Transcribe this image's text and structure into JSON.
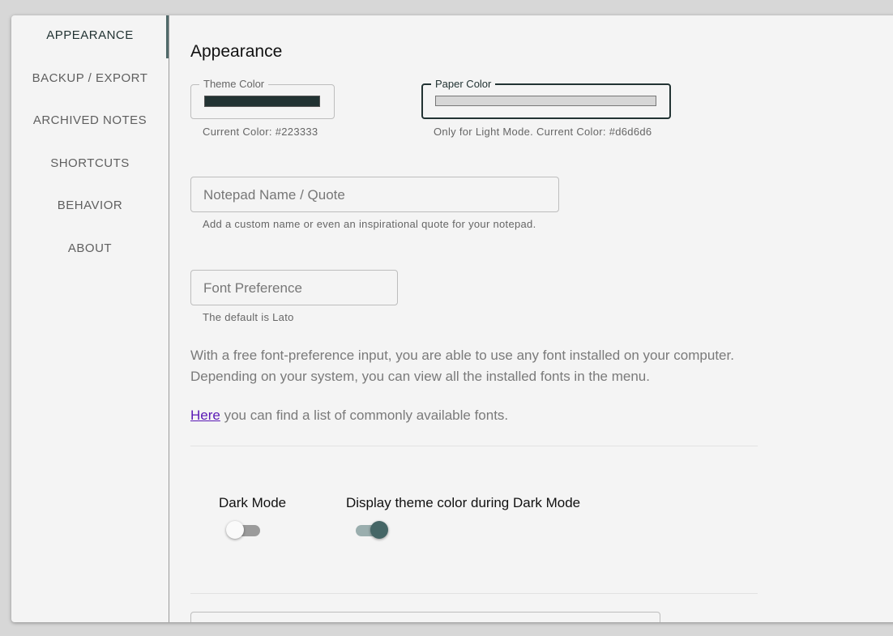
{
  "sidebar": {
    "items": [
      {
        "label": "APPEARANCE"
      },
      {
        "label": "BACKUP / EXPORT"
      },
      {
        "label": "ARCHIVED NOTES"
      },
      {
        "label": "SHORTCUTS"
      },
      {
        "label": "BEHAVIOR"
      },
      {
        "label": "ABOUT"
      }
    ]
  },
  "main": {
    "title": "Appearance",
    "theme_color": {
      "label": "Theme Color",
      "value": "#223333",
      "helper": "Current Color: #223333"
    },
    "paper_color": {
      "label": "Paper Color",
      "value": "#d6d6d6",
      "helper": "Only for Light Mode. Current Color: #d6d6d6"
    },
    "notepad_name": {
      "placeholder": "Notepad Name / Quote",
      "helper": "Add a custom name or even an inspirational quote for your notepad."
    },
    "font_preference": {
      "placeholder": "Font Preference",
      "helper": "The default is Lato"
    },
    "font_info": "With a free font-preference input, you are able to use any font installed on your computer. Depending on your system, you can view all the installed fonts in the menu.",
    "fonts_link": {
      "link_text": "Here",
      "rest_text": " you can find a list of commonly available fonts."
    },
    "dark_mode": {
      "label": "Dark Mode",
      "checked": false
    },
    "theme_dark_mode": {
      "label": "Display theme color during Dark Mode",
      "checked": true
    }
  },
  "colors": {
    "accent": "#223333",
    "toggle_on": "#456666",
    "link": "#5a19b5"
  }
}
